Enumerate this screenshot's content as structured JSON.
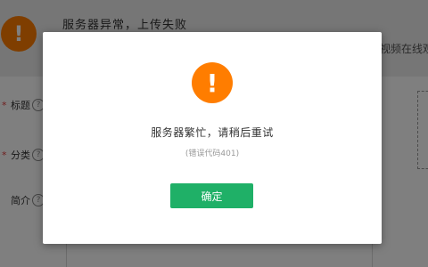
{
  "background": {
    "banner": {
      "icon": "exclamation-icon",
      "icon_glyph": "!",
      "title": "服务器异常，上传失败",
      "subtitle": "视频在线观"
    },
    "form": {
      "fields": [
        {
          "label": "标题",
          "required": true,
          "help_glyph": "?"
        },
        {
          "label": "分类",
          "required": true,
          "help_glyph": "?"
        },
        {
          "label": "简介",
          "required": false,
          "help_glyph": "?"
        }
      ],
      "required_mark": "*"
    }
  },
  "dialog": {
    "icon": "exclamation-icon",
    "icon_glyph": "!",
    "message": "服务器繁忙，请稍后重试",
    "error_code": "(错误代码401)",
    "confirm_label": "确定"
  },
  "colors": {
    "warning": "#ff7d00",
    "primary_button": "#1fb067",
    "overlay": "rgba(0,0,0,0.5)"
  }
}
